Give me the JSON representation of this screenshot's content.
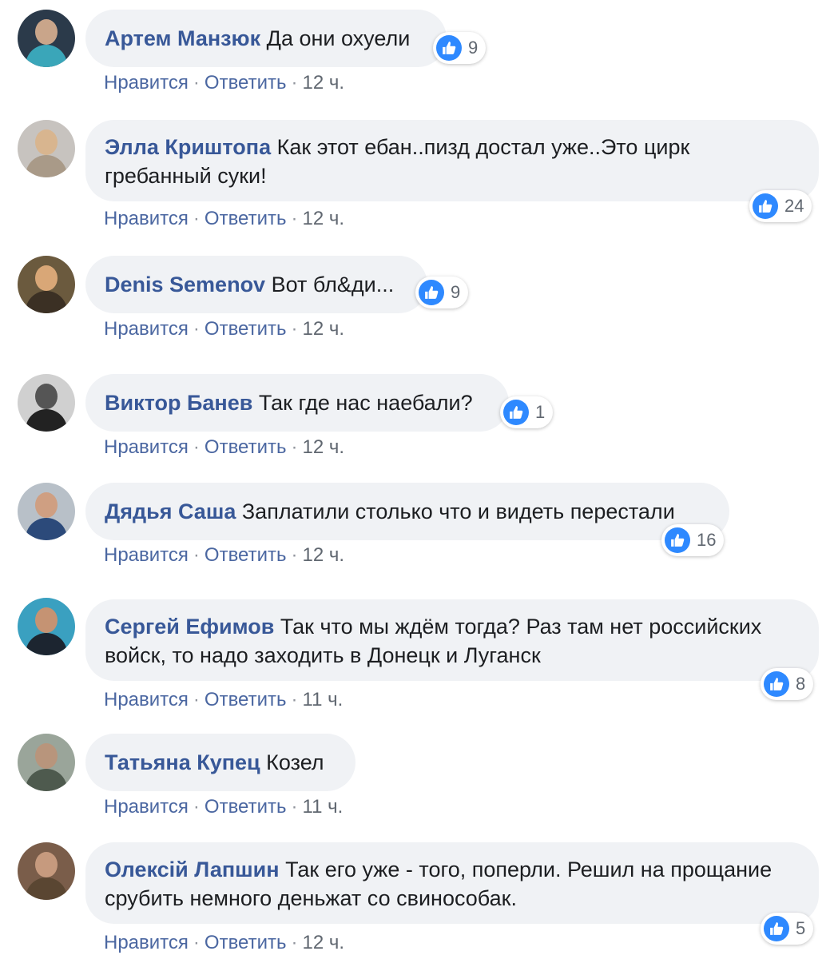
{
  "actions": {
    "like": "Нравится",
    "reply": "Ответить"
  },
  "colors": {
    "author": "#385898",
    "bubble": "#f0f2f5",
    "like": "#2e89ff"
  },
  "comments": [
    {
      "author": "Артем Манзюк",
      "text": "Да они охуели",
      "likes": "9",
      "time": "12 ч."
    },
    {
      "author": "Элла Криштопа",
      "text": "Как этот ебан..пизд достал уже..Это цирк гребанный суки!",
      "likes": "24",
      "time": "12 ч."
    },
    {
      "author": "Denis Semenov",
      "text": "Вот бл&ди...",
      "likes": "9",
      "time": "12 ч."
    },
    {
      "author": "Виктор Банев",
      "text": "Так где нас наебали?",
      "likes": "1",
      "time": "12 ч."
    },
    {
      "author": "Дядья Саша",
      "text": "Заплатили столько что и видеть перестали",
      "likes": "16",
      "time": "12 ч."
    },
    {
      "author": "Сергей Ефимов",
      "text": "Так что мы ждём тогда? Раз там нет российских войск, то надо заходить в Донецк и Луганск",
      "likes": "8",
      "time": "11 ч."
    },
    {
      "author": "Татьяна Купец",
      "text": "Козел",
      "likes": "",
      "time": "11 ч."
    },
    {
      "author": "Олексій Лапшин",
      "text": "Так его уже - того, поперли. Решил на прощание срубить немного деньжат со свинособак.",
      "likes": "5",
      "time": "12 ч."
    }
  ]
}
